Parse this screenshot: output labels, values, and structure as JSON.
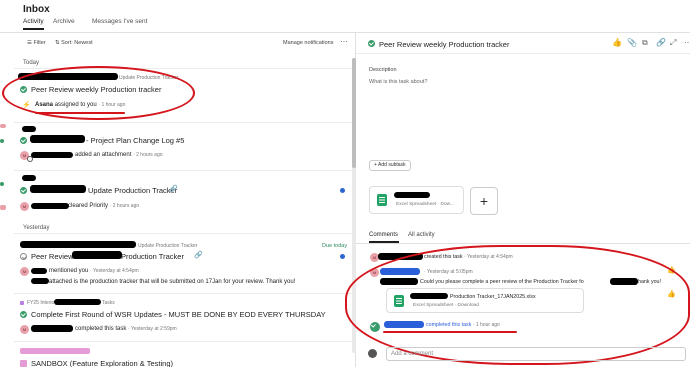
{
  "header": {
    "title": "Inbox"
  },
  "tabs": [
    {
      "label": "Activity"
    },
    {
      "label": "Archive"
    },
    {
      "label": "Messages I've sent"
    }
  ],
  "toolbar": {
    "filter": "Filter",
    "sort": "Sort: Newest",
    "manage": "Manage notifications",
    "more": "···"
  },
  "sections": {
    "today": "Today",
    "yesterday": "Yesterday"
  },
  "items": [
    {
      "project_line": "Update Production Tracker",
      "title": "Peer Review weekly Production tracker",
      "actor": "Asana",
      "action": "assigned to you",
      "time": "· 1 hour ago"
    },
    {
      "title": "- Project Plan Change Log #5",
      "action": "added an attachment",
      "time": "· 2 hours ago"
    },
    {
      "title": "Update Production Tracker",
      "action": "cleared Priority",
      "time": "· 2 hours ago"
    },
    {
      "project_line": "Update Production Tracker",
      "due": "Due today",
      "title_prefix": "Peer Review",
      "title_suffix": "Production Tracker",
      "mention": "mentioned you",
      "time": "· Yesterday at 4:54pm",
      "body": "attached is the production tracker that will be submitted on 17Jan for your review. Thank you!"
    },
    {
      "project_prefix": "FY25 Interio",
      "project_suffix": "Tasks",
      "title": "Complete First Round of WSR Updates - MUST BE DONE BY EOD EVERY THURSDAY",
      "action": "completed this task",
      "time": "· Yesterday at 2:59pm"
    },
    {
      "title": "SANDBOX (Feature Exploration & Testing)"
    }
  ],
  "detail": {
    "title": "Peer Review weekly Production tracker",
    "description_label": "Description",
    "description_placeholder": "What is this task about?",
    "add_subtask": "+ Add subtask",
    "attachment": {
      "type": "Excel Spreadsheet · Dow..."
    },
    "plus": "+",
    "comment_tabs": [
      "Comments",
      "All activity"
    ],
    "activity": [
      {
        "text": "created this task",
        "time": "· Yesterday at 4:54pm"
      },
      {
        "time": "· Yesterday at 5:05pm",
        "text_a": "Could you please complete a peer review of the Production Tracker fo",
        "text_b": "hank you!"
      },
      {
        "file": "Production Tracker_17JAN2025.xlsx",
        "file_meta": "Excel Spreadsheet · Download"
      },
      {
        "text": "completed this task",
        "time": "· 1 hour ago"
      }
    ],
    "comment_placeholder": "Add a comment"
  },
  "colors": {
    "accent_green": "#3a9b6b",
    "annotation_red": "#d4151c",
    "redact_blue": "#2b5fd9"
  }
}
